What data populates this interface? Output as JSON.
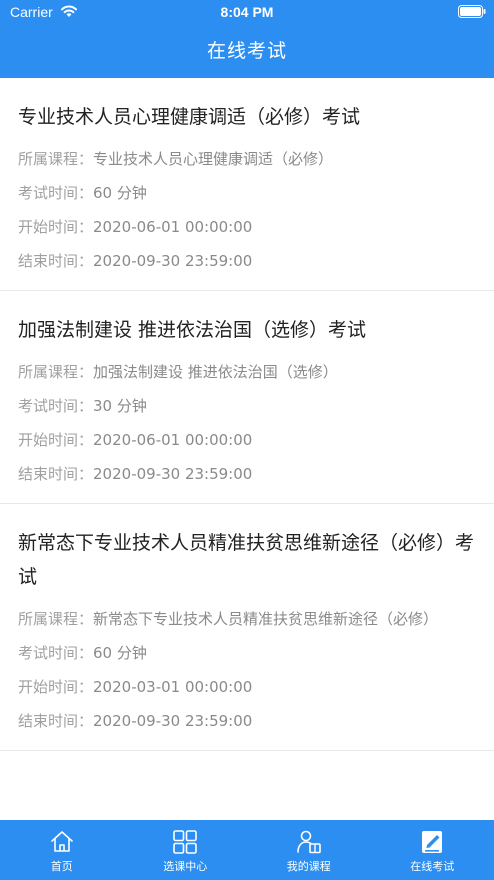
{
  "status_bar": {
    "carrier": "Carrier",
    "time": "8:04 PM"
  },
  "header": {
    "title": "在线考试"
  },
  "exams": [
    {
      "title": "专业技术人员心理健康调适（必修）考试",
      "course_label": "所属课程：",
      "course": "专业技术人员心理健康调适（必修）",
      "duration_label": "考试时间：",
      "duration": "60 分钟",
      "start_label": "开始时间：",
      "start": "2020-06-01 00:00:00",
      "end_label": "结束时间：",
      "end": "2020-09-30 23:59:00"
    },
    {
      "title": "加强法制建设 推进依法治国（选修）考试",
      "course_label": "所属课程：",
      "course": "加强法制建设 推进依法治国（选修）",
      "duration_label": "考试时间：",
      "duration": "30 分钟",
      "start_label": "开始时间：",
      "start": "2020-06-01 00:00:00",
      "end_label": "结束时间：",
      "end": "2020-09-30 23:59:00"
    },
    {
      "title": "新常态下专业技术人员精准扶贫思维新途径（必修）考试",
      "course_label": "所属课程：",
      "course": "新常态下专业技术人员精准扶贫思维新途径（必修）",
      "duration_label": "考试时间：",
      "duration": "60 分钟",
      "start_label": "开始时间：",
      "start": "2020-03-01 00:00:00",
      "end_label": "结束时间：",
      "end": "2020-09-30 23:59:00"
    }
  ],
  "tab_bar": {
    "items": [
      {
        "label": "首页",
        "icon": "home-icon"
      },
      {
        "label": "选课中心",
        "icon": "grid-icon"
      },
      {
        "label": "我的课程",
        "icon": "user-book-icon"
      },
      {
        "label": "在线考试",
        "icon": "edit-icon"
      }
    ],
    "active_index": 3
  },
  "colors": {
    "primary": "#2b8ef0",
    "title_text": "#222222",
    "meta_text": "#8a8a8a",
    "divider": "#e8e8e8"
  }
}
